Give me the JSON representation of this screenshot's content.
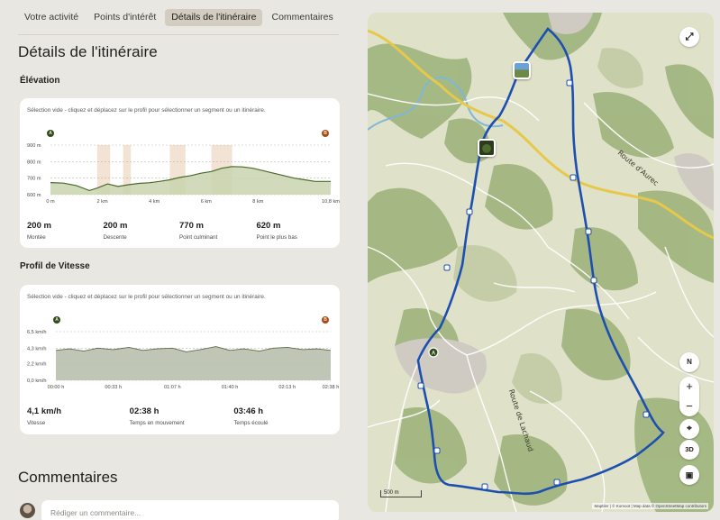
{
  "tabs": [
    {
      "label": "Votre activité",
      "active": false
    },
    {
      "label": "Points d'intérêt",
      "active": false
    },
    {
      "label": "Détails de l'itinéraire",
      "active": true
    },
    {
      "label": "Commentaires",
      "active": false
    }
  ],
  "page_title": "Détails de l'itinéraire",
  "elevation": {
    "title": "Élévation",
    "hint": "Sélection vide - cliquez et déplacez sur le profil pour sélectionner un segment ou un itinéraire.",
    "start_marker": "A",
    "end_marker": "B",
    "chart_data": {
      "type": "area",
      "x_unit": "km",
      "y_unit": "m",
      "x_ticks": [
        "0 m",
        "2 km",
        "4 km",
        "6 km",
        "8 km",
        "10,8 km"
      ],
      "y_ticks": [
        "900 m",
        "800 m",
        "700 m",
        "600 m"
      ],
      "xlim": [
        0,
        10.8
      ],
      "ylim": [
        600,
        900
      ],
      "x": [
        0,
        0.5,
        1.0,
        1.5,
        1.8,
        2.2,
        2.6,
        3.0,
        3.4,
        3.8,
        4.2,
        4.6,
        5.0,
        5.4,
        5.8,
        6.2,
        6.6,
        7.0,
        7.4,
        7.8,
        8.2,
        8.6,
        9.0,
        9.4,
        9.8,
        10.2,
        10.8
      ],
      "y": [
        673,
        670,
        655,
        625,
        640,
        665,
        650,
        660,
        668,
        672,
        680,
        690,
        705,
        715,
        730,
        740,
        760,
        770,
        768,
        760,
        745,
        730,
        715,
        700,
        690,
        680,
        680
      ]
    },
    "stats": [
      {
        "value": "200 m",
        "label": "Montée"
      },
      {
        "value": "200 m",
        "label": "Descente"
      },
      {
        "value": "770 m",
        "label": "Point culminant"
      },
      {
        "value": "620 m",
        "label": "Point le plus bas"
      }
    ],
    "colors": {
      "line": "#4b6a2a",
      "fill": "#c9d4ae",
      "climb": "#d9ae88"
    }
  },
  "speed": {
    "title": "Profil de Vitesse",
    "hint": "Sélection vide - cliquez et déplacez sur le profil pour sélectionner un segment ou un itinéraire.",
    "start_marker": "A",
    "end_marker": "B",
    "chart_data": {
      "type": "area",
      "x_ticks": [
        "00:00 h",
        "00:33 h",
        "01:07 h",
        "01:40 h",
        "02:13 h",
        "02:38 h"
      ],
      "y_ticks": [
        "6,5 km/h",
        "4,3 km/h",
        "2,2 km/h",
        "0,0 km/h"
      ],
      "ylim": [
        0,
        6.5
      ],
      "x_minutes": [
        0,
        8,
        16,
        24,
        33,
        42,
        50,
        58,
        67,
        75,
        83,
        92,
        100,
        108,
        117,
        125,
        133,
        142,
        150,
        158
      ],
      "speed_kmh": [
        4.0,
        4.2,
        3.9,
        4.3,
        4.1,
        4.4,
        4.0,
        4.2,
        4.3,
        3.8,
        4.1,
        4.5,
        4.0,
        4.2,
        3.9,
        4.3,
        4.4,
        4.1,
        4.2,
        4.0
      ]
    },
    "stats": [
      {
        "value": "4,1 km/h",
        "label": "Vitesse"
      },
      {
        "value": "02:38 h",
        "label": "Temps en mouvement"
      },
      {
        "value": "03:46 h",
        "label": "Temps écoulé"
      }
    ],
    "colors": {
      "line": "#5e6a4c",
      "fill": "#b9c0ad"
    }
  },
  "comments": {
    "title": "Commentaires",
    "placeholder": "Rédiger un commentaire..."
  },
  "map": {
    "road_labels": [
      "Route d'Aurec",
      "Route de Lachaud"
    ],
    "scale_label": "500 m",
    "compass": "N",
    "mode_3d": "3D",
    "zoom_in": "+",
    "zoom_out": "−",
    "attribution": "Maptiler | © Komoot | Map data © OpenStreetMap contributors",
    "start_marker": "A",
    "colors": {
      "route": "#1d4fb0",
      "terrain": "#d8dcc2",
      "forest": "#8fa86a",
      "major_road": "#e6c84a"
    }
  }
}
